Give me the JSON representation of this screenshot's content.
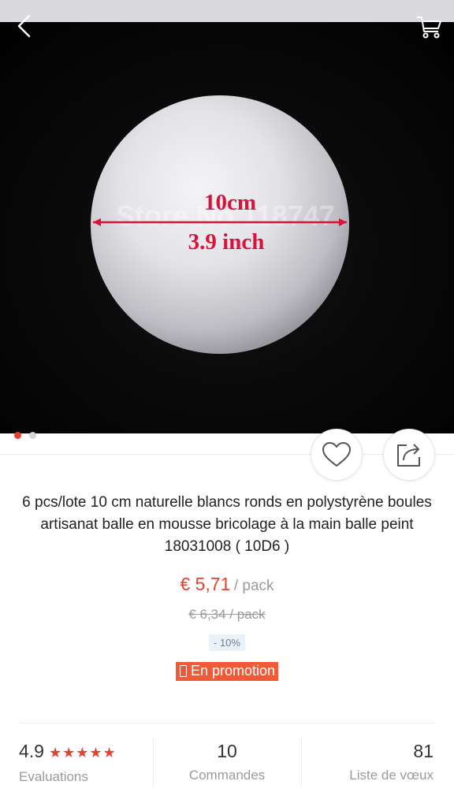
{
  "hero": {
    "overlay_dimension_cm": "10cm",
    "overlay_dimension_inch": "3.9 inch",
    "watermark": "Store No.118747",
    "slide_count": 2,
    "active_slide": 1
  },
  "product": {
    "title": "6 pcs/lote 10 cm naturelle blancs ronds en polystyrène boules artisanat balle en mousse bricolage à la main balle peint 18031008 ( 10D6 )"
  },
  "pricing": {
    "price": "€ 5,71",
    "per_unit": "/ pack",
    "old_price": "€ 6,34  / pack",
    "discount": "- 10%",
    "promo_label": "En promotion"
  },
  "stats": {
    "rating": "4.9",
    "rating_stars": 5,
    "rating_label": "Evaluations",
    "orders": "10",
    "orders_label": "Commandes",
    "wishlist": "81",
    "wishlist_label": "Liste de vœux"
  },
  "colors": {
    "accent": "#e8412f",
    "promo_bg": "#f05a37",
    "muted_text": "#9a9a9a",
    "discount_bg": "#eaf1f8"
  },
  "icons": {
    "back": "chevron-left-icon",
    "cart": "cart-icon",
    "wishlist": "heart-icon",
    "share": "share-icon",
    "promo": "phone-icon"
  }
}
